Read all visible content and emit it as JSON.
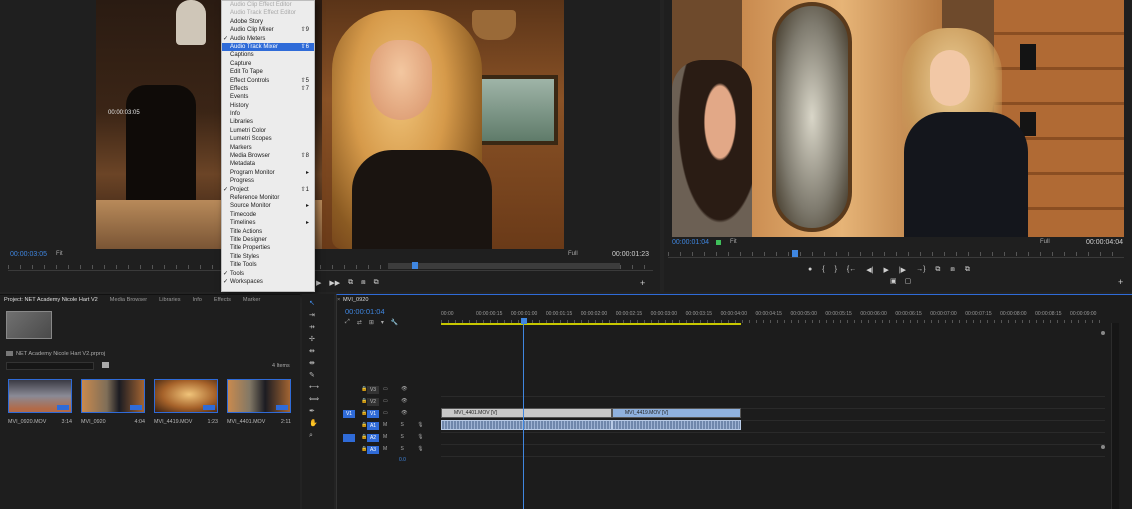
{
  "source_monitor": {
    "in_point": "00:00:03:05",
    "timecode": "00:00:03:05",
    "zoom": "Fit",
    "quality": "Full",
    "duration": "00:00:01:23",
    "transport": [
      "◀",
      "▶",
      "▶▶",
      "⧉",
      "⧈",
      "⧉",
      "+"
    ]
  },
  "program_monitor": {
    "timecode": "00:00:01:04",
    "zoom": "Fit",
    "quality": "Full",
    "duration": "00:00:04:04",
    "transport": [
      "●",
      "{",
      "}",
      "{←",
      "◀|",
      "▶",
      "|▶",
      "→}",
      "⧉",
      "⧈",
      "⧉"
    ],
    "extra": [
      "▣",
      "▢"
    ]
  },
  "window_menu": {
    "items": [
      {
        "label": "Audio Clip Effect Editor",
        "shortcut": "",
        "checked": false,
        "dim": true,
        "submenu": false
      },
      {
        "label": "Audio Track Effect Editor",
        "shortcut": "",
        "checked": false,
        "dim": true,
        "submenu": false
      },
      {
        "label": "Adobe Story",
        "shortcut": "",
        "checked": false,
        "dim": false,
        "submenu": false
      },
      {
        "label": "Audio Clip Mixer",
        "shortcut": "⇧9",
        "checked": false,
        "dim": false,
        "submenu": false
      },
      {
        "label": "Audio Meters",
        "shortcut": "",
        "checked": true,
        "dim": false,
        "submenu": false
      },
      {
        "label": "Audio Track Mixer",
        "shortcut": "⇧6",
        "checked": false,
        "dim": false,
        "submenu": false,
        "highlighted": true
      },
      {
        "label": "Captions",
        "shortcut": "",
        "checked": false,
        "dim": false,
        "submenu": false
      },
      {
        "label": "Capture",
        "shortcut": "",
        "checked": false,
        "dim": false,
        "submenu": false
      },
      {
        "label": "Edit To Tape",
        "shortcut": "",
        "checked": false,
        "dim": false,
        "submenu": false
      },
      {
        "label": "Effect Controls",
        "shortcut": "⇧5",
        "checked": false,
        "dim": false,
        "submenu": false
      },
      {
        "label": "Effects",
        "shortcut": "⇧7",
        "checked": false,
        "dim": false,
        "submenu": false
      },
      {
        "label": "Events",
        "shortcut": "",
        "checked": false,
        "dim": false,
        "submenu": false
      },
      {
        "label": "History",
        "shortcut": "",
        "checked": false,
        "dim": false,
        "submenu": false
      },
      {
        "label": "Info",
        "shortcut": "",
        "checked": false,
        "dim": false,
        "submenu": false
      },
      {
        "label": "Libraries",
        "shortcut": "",
        "checked": false,
        "dim": false,
        "submenu": false
      },
      {
        "label": "Lumetri Color",
        "shortcut": "",
        "checked": false,
        "dim": false,
        "submenu": false
      },
      {
        "label": "Lumetri Scopes",
        "shortcut": "",
        "checked": false,
        "dim": false,
        "submenu": false
      },
      {
        "label": "Markers",
        "shortcut": "",
        "checked": false,
        "dim": false,
        "submenu": false
      },
      {
        "label": "Media Browser",
        "shortcut": "⇧8",
        "checked": false,
        "dim": false,
        "submenu": false
      },
      {
        "label": "Metadata",
        "shortcut": "",
        "checked": false,
        "dim": false,
        "submenu": false
      },
      {
        "label": "Program Monitor",
        "shortcut": "▸",
        "checked": false,
        "dim": false,
        "submenu": true
      },
      {
        "label": "Progress",
        "shortcut": "",
        "checked": false,
        "dim": false,
        "submenu": false
      },
      {
        "label": "Project",
        "shortcut": "⇧1",
        "checked": true,
        "dim": false,
        "submenu": false
      },
      {
        "label": "Reference Monitor",
        "shortcut": "",
        "checked": false,
        "dim": false,
        "submenu": false
      },
      {
        "label": "Source Monitor",
        "shortcut": "▸",
        "checked": false,
        "dim": false,
        "submenu": true
      },
      {
        "label": "Timecode",
        "shortcut": "",
        "checked": false,
        "dim": false,
        "submenu": false
      },
      {
        "label": "Timelines",
        "shortcut": "▸",
        "checked": false,
        "dim": false,
        "submenu": true
      },
      {
        "label": "Title Actions",
        "shortcut": "",
        "checked": false,
        "dim": false,
        "submenu": false
      },
      {
        "label": "Title Designer",
        "shortcut": "",
        "checked": false,
        "dim": false,
        "submenu": false
      },
      {
        "label": "Title Properties",
        "shortcut": "",
        "checked": false,
        "dim": false,
        "submenu": false
      },
      {
        "label": "Title Styles",
        "shortcut": "",
        "checked": false,
        "dim": false,
        "submenu": false
      },
      {
        "label": "Title Tools",
        "shortcut": "",
        "checked": false,
        "dim": false,
        "submenu": false
      },
      {
        "label": "Tools",
        "shortcut": "",
        "checked": true,
        "dim": false,
        "submenu": false
      },
      {
        "label": "Workspaces",
        "shortcut": "",
        "checked": true,
        "dim": false,
        "submenu": false
      }
    ]
  },
  "project_panel": {
    "tabs": [
      "Project: NET Academy Nicole Hart V2",
      "Media Browser",
      "Libraries",
      "Info",
      "Effects",
      "Marker"
    ],
    "file": "NET Academy Nicole Hart V2.prproj",
    "search_placeholder": "",
    "item_count": "4 Items",
    "clips": [
      {
        "name": "MVI_0920.MOV",
        "duration": "3:14"
      },
      {
        "name": "MVI_0920",
        "duration": "4:04"
      },
      {
        "name": "MVI_4419.MOV",
        "duration": "1:23"
      },
      {
        "name": "MVI_4401.MOV",
        "duration": "2:11"
      }
    ]
  },
  "tools": [
    "↖",
    "⇥",
    "⇸",
    "✢",
    "⇹",
    "⇼",
    "✎",
    "⟷",
    "⟺",
    "✒",
    "✋",
    "⌕"
  ],
  "timeline": {
    "sequence_name": "MVI_0920",
    "timecode": "00:00:01:04",
    "toolbar": [
      "⤢",
      "⇄",
      "⊞",
      "▾",
      "🔧"
    ],
    "ruler_labels": [
      "00:00",
      "00:00:00:15",
      "00:00:01:00",
      "00:00:01:15",
      "00:00:02:00",
      "00:00:02:15",
      "00:00:03:00",
      "00:00:03:15",
      "00:00:04:00",
      "00:00:04:15",
      "00:00:05:00",
      "00:00:05:15",
      "00:00:06:00",
      "00:00:06:15",
      "00:00:07:00",
      "00:00:07:15",
      "00:00:08:00",
      "00:00:08:15",
      "00:00:09:00"
    ],
    "tracks": [
      {
        "name": "V3",
        "target": "",
        "controls": "▭ 👁"
      },
      {
        "name": "V2",
        "target": "",
        "controls": "▭ 👁"
      },
      {
        "name": "V1",
        "target": "V1",
        "controls": "▭ 👁"
      },
      {
        "name": "A1",
        "target": "A1",
        "controls": "M S 🎙"
      },
      {
        "name": "A2",
        "target": "",
        "controls": "M S 🎙"
      },
      {
        "name": "A3",
        "target": "",
        "controls": "M S 🎙"
      }
    ],
    "master_volume": "0.0",
    "clips": {
      "v1_a": "MVI_4401.MOV [V]",
      "v1_b": "MVI_4419.MOV [V]"
    }
  }
}
